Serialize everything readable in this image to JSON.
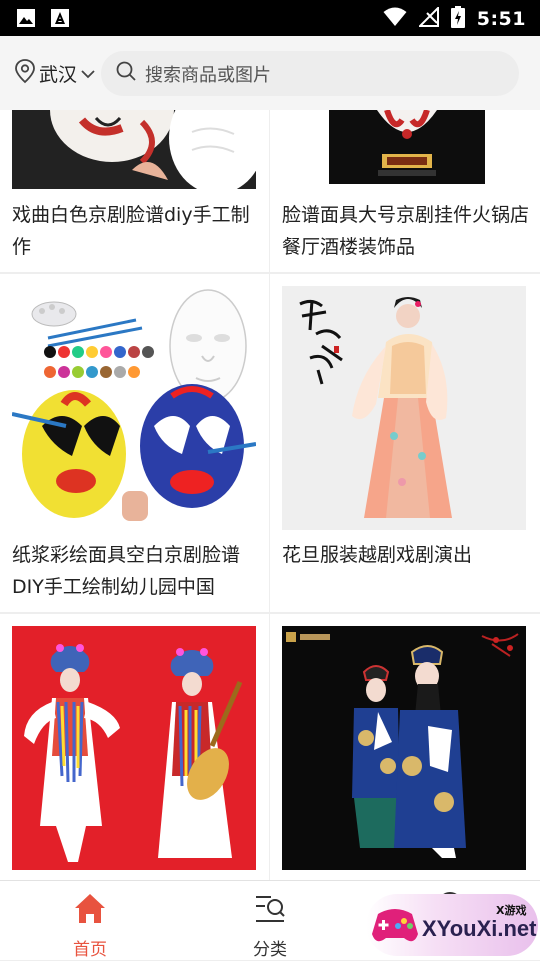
{
  "status_bar": {
    "time": "5:51"
  },
  "header": {
    "location": "武汉",
    "search_placeholder": "搜索商品或图片"
  },
  "products": [
    {
      "title": "戏曲白色京剧脸谱diy手工制作"
    },
    {
      "title": "脸谱面具大号京剧挂件火锅店餐厅酒楼装饰品"
    },
    {
      "title": "纸浆彩绘面具空白京剧脸谱DIY手工绘制幼儿园中国"
    },
    {
      "title": "花旦服装越剧戏剧演出"
    },
    {
      "title": ""
    },
    {
      "title": ""
    }
  ],
  "tabs": [
    {
      "label": "首页",
      "active": true
    },
    {
      "label": "分类",
      "active": false
    },
    {
      "label": "",
      "active": false
    }
  ],
  "watermark": {
    "text": "XYouXi.net",
    "small_text": "X游戏"
  },
  "colors": {
    "accent": "#e8533f",
    "text": "#222222",
    "divider": "#eeeeee"
  }
}
